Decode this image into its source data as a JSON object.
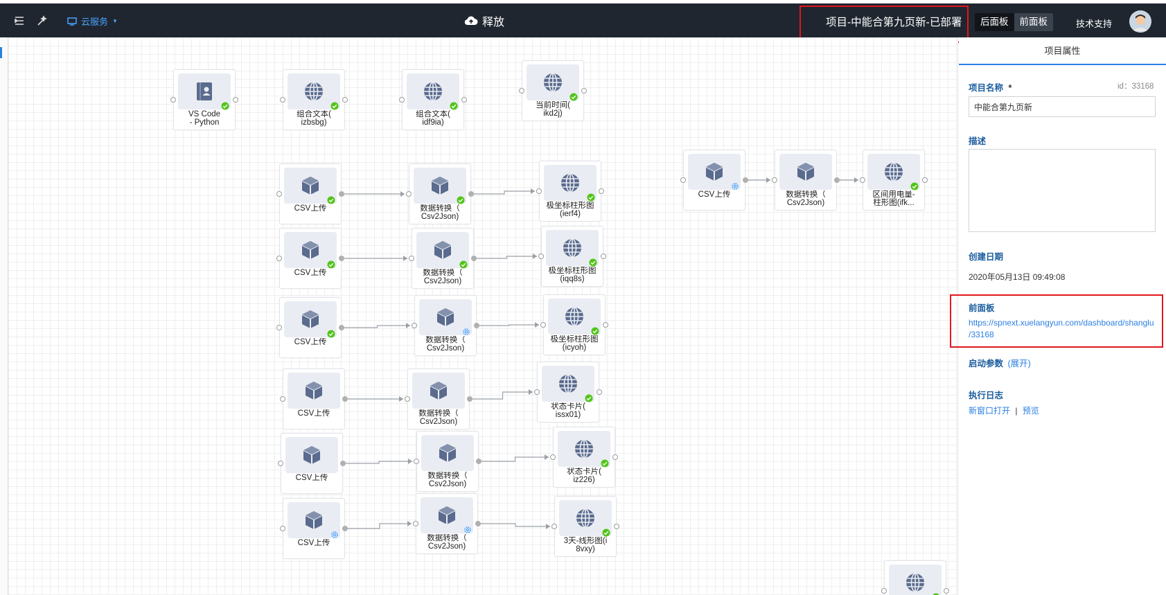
{
  "topbar": {
    "cloud_service_label": "云服务",
    "release_label": "释放",
    "project_title": "项目-中能合第九页新-已部署",
    "back_panel_label": "后面板",
    "front_panel_label": "前面板",
    "support_label": "技术支持"
  },
  "canvas": {
    "nodes": [
      {
        "icon": "book",
        "label": "VS Code\n- Python",
        "status": "ok"
      },
      {
        "icon": "globe",
        "label": "组合文本(\nizbsbg)",
        "status": "ok"
      },
      {
        "icon": "globe",
        "label": "组合文本(\nidf9ia)",
        "status": "ok"
      },
      {
        "icon": "globe",
        "label": "当前时间(\nikd2j)",
        "status": "ok"
      },
      {
        "icon": "cube",
        "label": "CSV上传",
        "status": "ok"
      },
      {
        "icon": "cube",
        "label": "数据转换（\nCsv2Json)",
        "status": "ok"
      },
      {
        "icon": "globe",
        "label": "极坐标柱形图\n(ierf4)",
        "status": "ok"
      },
      {
        "icon": "cube",
        "label": "CSV上传",
        "status": "ok"
      },
      {
        "icon": "cube",
        "label": "数据转换（\nCsv2Json)",
        "status": "ok"
      },
      {
        "icon": "globe",
        "label": "极坐标柱形图\n(iqq8s)",
        "status": "ok"
      },
      {
        "icon": "cube",
        "label": "CSV上传",
        "status": "ok"
      },
      {
        "icon": "cube",
        "label": "数据转换（\nCsv2Json)",
        "status": "gear"
      },
      {
        "icon": "globe",
        "label": "极坐标柱形图\n(icyoh)",
        "status": "ok"
      },
      {
        "icon": "cube",
        "label": "CSV上传",
        "status": "none"
      },
      {
        "icon": "cube",
        "label": "数据转换（\nCsv2Json)",
        "status": "none"
      },
      {
        "icon": "globe",
        "label": "状态卡片(\nissx01)",
        "status": "ok"
      },
      {
        "icon": "cube",
        "label": "CSV上传",
        "status": "none"
      },
      {
        "icon": "cube",
        "label": "数据转换（\nCsv2Json)",
        "status": "none"
      },
      {
        "icon": "globe",
        "label": "状态卡片(\niz226)",
        "status": "ok"
      },
      {
        "icon": "cube",
        "label": "CSV上传",
        "status": "gear"
      },
      {
        "icon": "cube",
        "label": "数据转换（\nCsv2Json)",
        "status": "gear"
      },
      {
        "icon": "globe",
        "label": "3天-线形图(i\n8vxy)",
        "status": "ok"
      },
      {
        "icon": "cube",
        "label": "CSV上传",
        "status": "gear"
      },
      {
        "icon": "cube",
        "label": "数据转换（\nCsv2Json)",
        "status": "none"
      },
      {
        "icon": "globe",
        "label": "区间用电量-\n柱形图(ifk...",
        "status": "ok"
      },
      {
        "icon": "globe",
        "label": "",
        "status": "ok"
      }
    ]
  },
  "panel": {
    "tab_label": "项目属性",
    "name_label": "项目名称",
    "required_mark": "*",
    "id_text": "id：33168",
    "name_value": "中能合第九页新",
    "desc_label": "描述",
    "created_label": "创建日期",
    "created_value": "2020年05月13日 09:49:08",
    "front_panel_label": "前面板",
    "front_panel_url_line1": "https://spnext.xuelangyun.com/dashboard/shanglu",
    "front_panel_url_line2": "/33168",
    "launch_params_label": "启动参数",
    "launch_params_toggle": "(展开)",
    "exec_log_label": "执行日志",
    "open_new_window": "新窗口打开",
    "separator": "|",
    "preview": "预览"
  },
  "colors": {
    "accent": "#2b7fe3",
    "topbar": "#1f2630",
    "highlight": "#e0171c",
    "ok": "#52c41a",
    "icon": "#5a6b8e"
  }
}
